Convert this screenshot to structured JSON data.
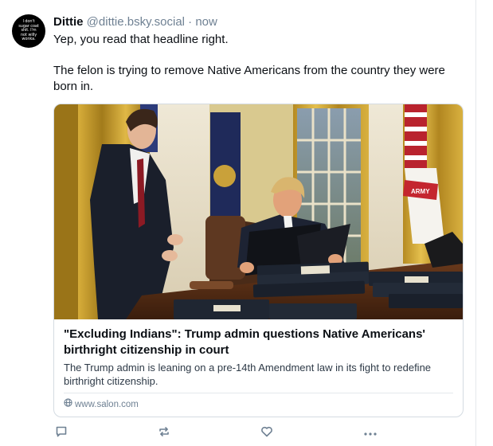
{
  "post": {
    "author": {
      "display_name": "Dittie",
      "handle": "@dittie.bsky.social",
      "avatar_text": "I don't sugar coat shit. I'm not willy wonka."
    },
    "separator": "·",
    "time": "now",
    "text_lines": [
      "Yep, you read that headline right.",
      "",
      "The felon is trying to remove Native Americans from the country they were born in."
    ],
    "embed": {
      "title": "\"Excluding Indians\": Trump admin questions Native Americans' birthright citizenship in court",
      "description": "The Trump admin is leaning on a pre-14th Amendment law in its fight to redefine birthright citizenship.",
      "domain": "www.salon.com",
      "image_alt": "Photo of a man signing documents at a desk in the Oval Office while an aide stands beside him",
      "image_flag_text": "ARMY"
    },
    "actions": [
      "reply-icon",
      "repost-icon",
      "like-icon",
      "more-icon"
    ]
  },
  "colors": {
    "text_primary": "#0b0f14",
    "text_secondary": "#6f8193",
    "border": "#d4dbe2",
    "background": "#ffffff"
  }
}
